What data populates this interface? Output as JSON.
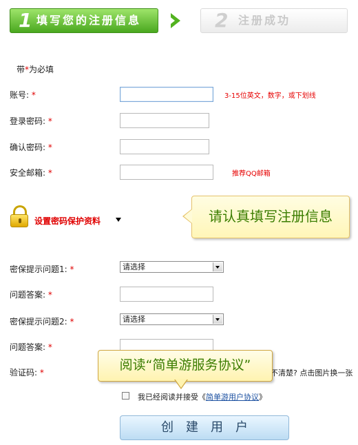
{
  "steps": {
    "step1_num": "1",
    "step1_label": "填写您的注册信息",
    "step2_num": "2",
    "step2_label": "注册成功"
  },
  "form": {
    "required_note_prefix": "带",
    "required_note_star": "*",
    "required_note_suffix": "为必填",
    "required_mark": "*",
    "account_label": "账号:",
    "account_hint": "3-15位英文，数字，或下划线",
    "password_label": "登录密码:",
    "confirm_label": "确认密码:",
    "email_label": "安全邮箱:",
    "email_hint": "推荐QQ邮箱",
    "pwd_protect_label": "设置密码保护资料",
    "question1_label": "密保提示问题1:",
    "question1_value": "请选择",
    "answer1_label": "问题答案:",
    "question2_label": "密保提示问题2:",
    "question2_value": "请选择",
    "answer2_label": "问题答案:",
    "captcha_label": "验证码:",
    "captcha_hint": "不清楚? 点击图片换一张",
    "agree_prefix": "我已经阅读并接受",
    "agree_link_open": "《",
    "agree_link": "简单游用户协议",
    "agree_link_close": "》",
    "create_button": "创建用户"
  },
  "tooltips": {
    "fill_info": "请认真填写注册信息",
    "read_agreement": "阅读“简单游服务协议”"
  },
  "colors": {
    "step_active": "#52b21f",
    "required": "#e00000",
    "tooltip_text": "#3a7d00",
    "button_bg": "#bcdcf3"
  }
}
